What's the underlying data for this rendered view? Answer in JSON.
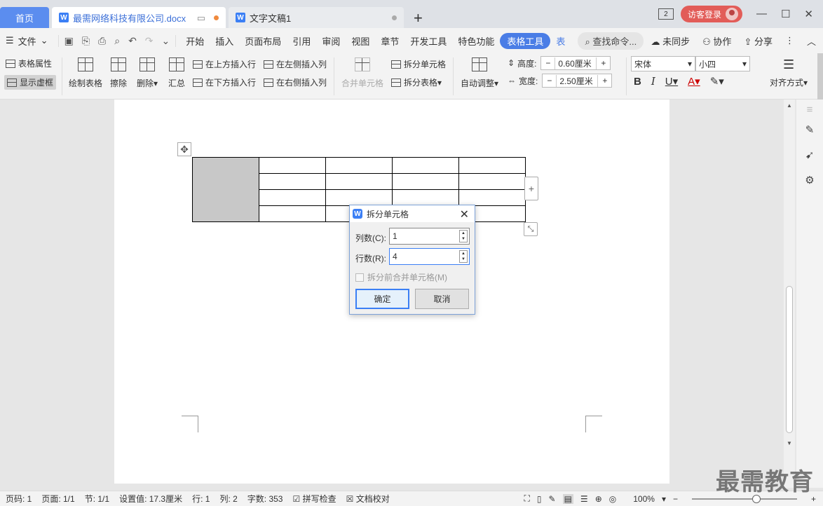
{
  "tabs": {
    "home": "首页",
    "doc1": "最需网络科技有限公司.docx",
    "doc2": "文字文稿1",
    "new_tab": "+"
  },
  "titlebar": {
    "badge": "2",
    "login": "访客登录",
    "minimize": "—",
    "restore": "☐",
    "close": "✕"
  },
  "menubar": {
    "file": "文件",
    "items": [
      "开始",
      "插入",
      "页面布局",
      "引用",
      "审阅",
      "视图",
      "章节",
      "开发工具",
      "特色功能"
    ],
    "table_tools": "表格工具",
    "more": "表",
    "search": "查找命令...",
    "sync": "未同步",
    "collab": "协作",
    "share": "分享"
  },
  "ribbon": {
    "table_props": "表格属性",
    "show_grid": "显示虚框",
    "draw_table": "绘制表格",
    "erase": "擦除",
    "delete": "删除",
    "summary": "汇总",
    "insert_above": "在上方插入行",
    "insert_below": "在下方插入行",
    "insert_left": "在左侧插入列",
    "insert_right": "在右侧插入列",
    "merge_cells": "合并单元格",
    "split_cells": "拆分单元格",
    "split_table": "拆分表格",
    "auto_fit": "自动调整",
    "height_label": "高度:",
    "height_value": "0.60厘米",
    "width_label": "宽度:",
    "width_value": "2.50厘米",
    "font_name": "宋体",
    "font_size": "小四",
    "align": "对齐方式"
  },
  "dialog": {
    "title": "拆分单元格",
    "cols_label": "列数(C):",
    "cols_value": "1",
    "rows_label": "行数(R):",
    "rows_value": "4",
    "merge_before": "拆分前合并单元格(M)",
    "ok": "确定",
    "cancel": "取消"
  },
  "statusbar": {
    "page_num": "页码: 1",
    "pages": "页面: 1/1",
    "section": "节: 1/1",
    "setting": "设置值: 17.3厘米",
    "row": "行: 1",
    "col": "列: 2",
    "words": "字数: 353",
    "spell": "拼写检查",
    "proof": "文档校对",
    "zoom": "100%"
  },
  "watermark": "最需教育"
}
